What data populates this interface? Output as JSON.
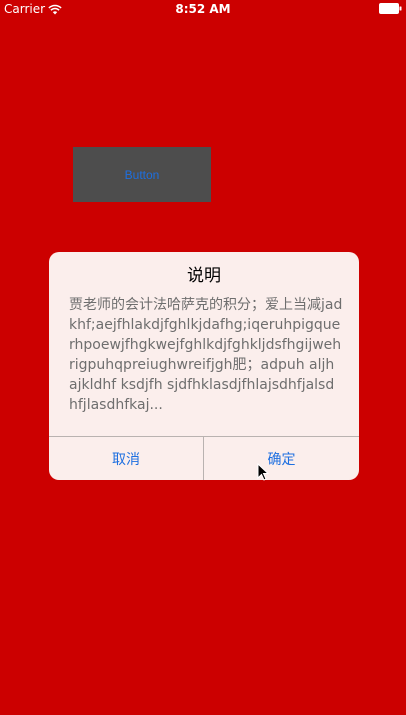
{
  "status_bar": {
    "carrier": "Carrier",
    "time": "8:52 AM",
    "wifi_icon": "wifi-icon",
    "battery_icon": "battery-icon"
  },
  "app_button": {
    "label": "Button"
  },
  "alert": {
    "title": "说明",
    "message": "贾老师的会计法哈萨克的积分；爱上当减jadkhf;aejfhlakdjfghlkjdafhg;iqeruhpigquerhpoewjfhgkwejfghlkdjfghkljdsfhgijwehrigpuhqpreiughwreifjgh肥；adpuh aljh ajkldhf ksdjfh sjdfhklasdjfhlajsdhfjalsdhfjlasdhfkaj...",
    "cancel_label": "取消",
    "confirm_label": "确定"
  },
  "colors": {
    "background": "#CC0000",
    "button_bg": "#4D4D4D",
    "accent": "#1E6FE0",
    "alert_bg": "#FBEEEC"
  }
}
